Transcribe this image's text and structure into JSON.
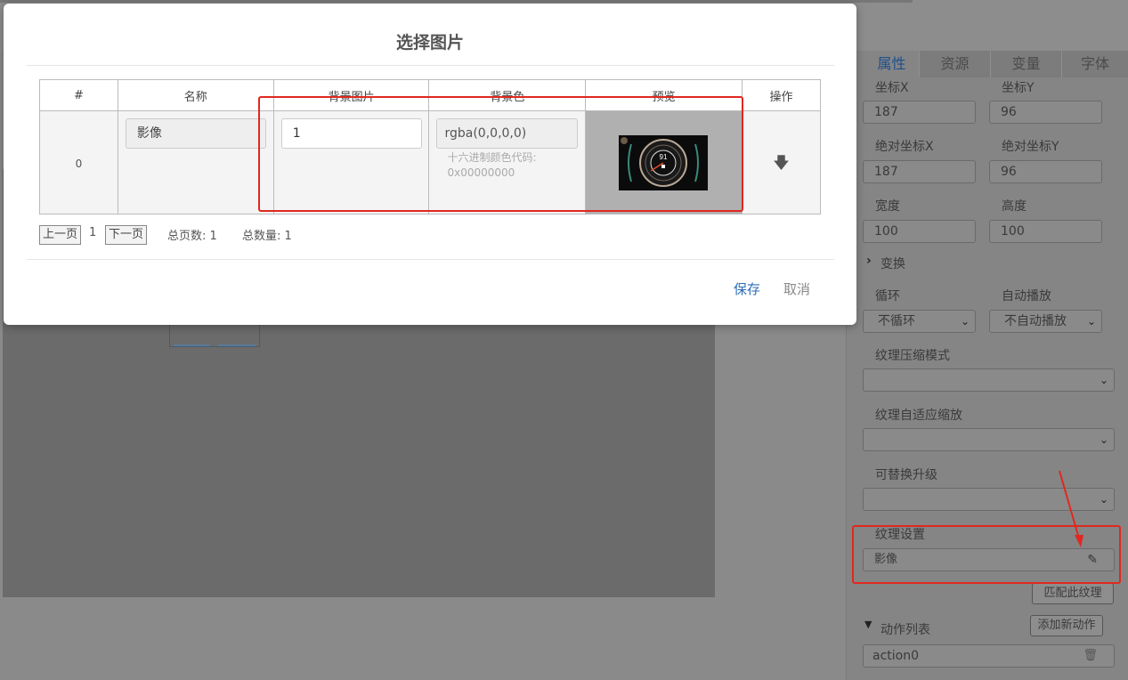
{
  "modal": {
    "title": "选择图片",
    "columns": [
      "#",
      "名称",
      "背景图片",
      "背景色",
      "预览",
      "操作"
    ],
    "row": {
      "index": "0",
      "name": "影像",
      "background_image": "1",
      "background_color": "rgba(0,0,0,0)",
      "hex_label": "十六进制颜色代码:",
      "hex_value": "0x00000000",
      "preview_speed": "91"
    },
    "pager": {
      "prev": "上一页",
      "current": "1",
      "next": "下一页",
      "total_pages_label": "总页数: 1",
      "total_count_label": "总数量: 1"
    },
    "save": "保存",
    "cancel": "取消"
  },
  "panel": {
    "tabs": [
      "属性",
      "资源",
      "变量",
      "字体"
    ],
    "x_label": "坐标X",
    "x_value": "187",
    "y_label": "坐标Y",
    "y_value": "96",
    "abs_x_label": "绝对坐标X",
    "abs_x_value": "187",
    "abs_y_label": "绝对坐标Y",
    "abs_y_value": "96",
    "width_label": "宽度",
    "width_value": "100",
    "height_label": "高度",
    "height_value": "100",
    "transform_label": "变换",
    "loop_label": "循环",
    "loop_value": "不循环",
    "autoplay_label": "自动播放",
    "autoplay_value": "不自动播放",
    "compress_label": "纹理压缩模式",
    "adaptive_label": "纹理自适应缩放",
    "replace_label": "可替换升级",
    "texture_label": "纹理设置",
    "texture_value": "影像",
    "match_texture": "匹配此纹理",
    "action_list_label": "动作列表",
    "add_action": "添加新动作",
    "action_item": "action0"
  },
  "colors": {
    "highlight": "#e0281f",
    "link": "#2b6fb6",
    "active_tab": "#1f4f8a"
  }
}
